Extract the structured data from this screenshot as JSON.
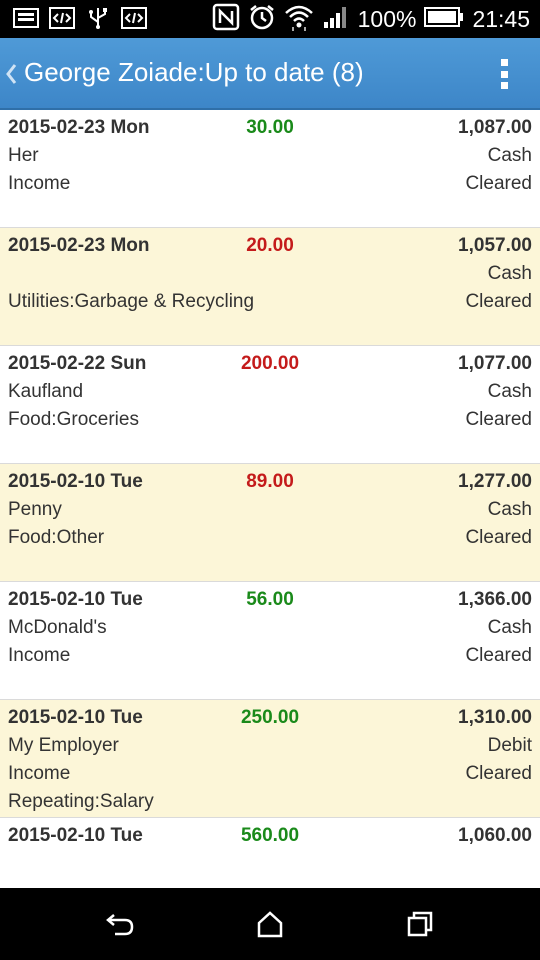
{
  "status_bar": {
    "battery": "100%",
    "time": "21:45",
    "icons": [
      "image-icon",
      "code-icon",
      "usb-icon",
      "code-icon",
      "nfc-icon",
      "alarm-icon",
      "wifi-icon",
      "signal-icon",
      "battery-icon"
    ]
  },
  "header": {
    "title": "George Zoiade:Up to date (8)",
    "accent": "#3d86c8"
  },
  "colors": {
    "income": "#1a8a1a",
    "expense": "#c41b1b",
    "alt_row": "#fcf6d8"
  },
  "transactions": [
    {
      "date": "2015-02-23 Mon",
      "amount": "30.00",
      "type": "income",
      "balance": "1,087.00",
      "payee": "Her",
      "account": "Cash",
      "category": "Income",
      "status": "Cleared"
    },
    {
      "date": "2015-02-23 Mon",
      "amount": "20.00",
      "type": "expense",
      "balance": "1,057.00",
      "payee": "",
      "account": "Cash",
      "category": "Utilities:Garbage & Recycling",
      "status": "Cleared"
    },
    {
      "date": "2015-02-22 Sun",
      "amount": "200.00",
      "type": "expense",
      "balance": "1,077.00",
      "payee": "Kaufland",
      "account": "Cash",
      "category": "Food:Groceries",
      "status": "Cleared"
    },
    {
      "date": "2015-02-10 Tue",
      "amount": "89.00",
      "type": "expense",
      "balance": "1,277.00",
      "payee": "Penny",
      "account": "Cash",
      "category": "Food:Other",
      "status": "Cleared"
    },
    {
      "date": "2015-02-10 Tue",
      "amount": "56.00",
      "type": "income",
      "balance": "1,366.00",
      "payee": "McDonald's",
      "account": "Cash",
      "category": "Income",
      "status": "Cleared"
    },
    {
      "date": "2015-02-10 Tue",
      "amount": "250.00",
      "type": "income",
      "balance": "1,310.00",
      "payee": "My Employer",
      "account": "Debit",
      "category": "Income",
      "status": "Cleared",
      "note": "Repeating:Salary"
    },
    {
      "date": "2015-02-10 Tue",
      "amount": "560.00",
      "type": "income",
      "balance": "1,060.00",
      "payee": "",
      "account": "",
      "category": "",
      "status": ""
    }
  ],
  "nav": [
    "back-icon",
    "home-icon",
    "recent-apps-icon"
  ]
}
